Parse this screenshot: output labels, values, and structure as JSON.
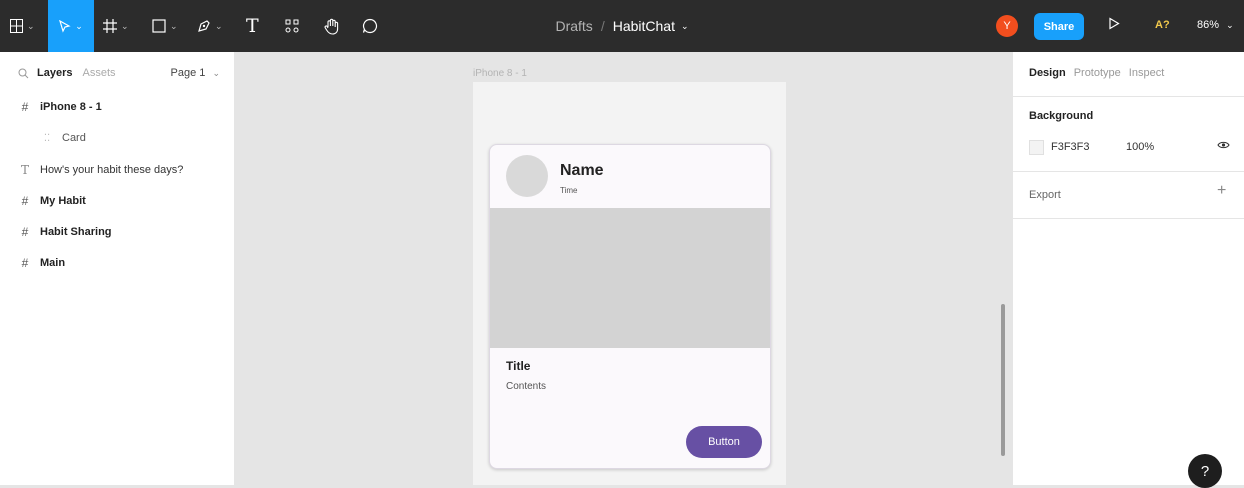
{
  "toolbar": {
    "breadcrumb": "Drafts",
    "separator": "/",
    "file_name": "HabitChat",
    "text_tool": "T",
    "avatar_initial": "Y",
    "share_label": "Share",
    "accessibility_label": "A?",
    "zoom": "86%"
  },
  "left_panel": {
    "tab_layers": "Layers",
    "tab_assets": "Assets",
    "page": "Page 1",
    "layers": [
      {
        "label": "iPhone 8 - 1",
        "icon": "frame-icon"
      },
      {
        "label": "Card",
        "icon": "component-icon"
      },
      {
        "label": "How's your habit these days?",
        "icon": "text-icon"
      },
      {
        "label": "My Habit",
        "icon": "frame-icon"
      },
      {
        "label": "Habit Sharing",
        "icon": "frame-icon"
      },
      {
        "label": "Main",
        "icon": "frame-icon"
      }
    ]
  },
  "canvas": {
    "frame_label": "iPhone 8 - 1",
    "card": {
      "name": "Name",
      "time": "Time",
      "title": "Title",
      "contents": "Contents",
      "button": "Button"
    }
  },
  "right_panel": {
    "tab_design": "Design",
    "tab_prototype": "Prototype",
    "tab_inspect": "Inspect",
    "background_title": "Background",
    "background_hex": "F3F3F3",
    "background_opacity": "100%",
    "export_title": "Export",
    "help": "?"
  },
  "colors": {
    "toolbar_bg": "#2c2c2c",
    "accent": "#18a0fb",
    "button_purple": "#6750a4",
    "avatar": "#f24e1e"
  }
}
